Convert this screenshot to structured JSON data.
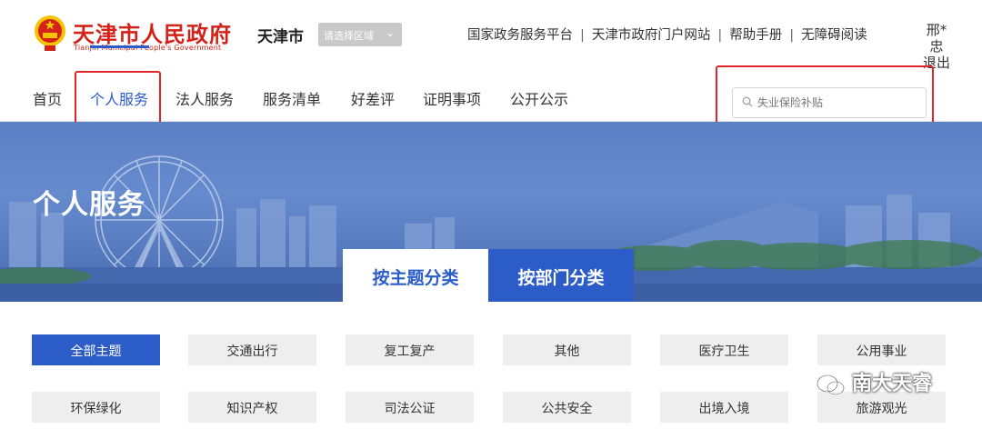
{
  "header": {
    "site_title": "天津市人民政府",
    "site_subtitle": "Tianjin Municipal People's Government",
    "city": "天津市",
    "region_select": {
      "placeholder": "请选择区域"
    },
    "top_links": [
      "国家政务服务平台",
      "天津市政府门户网站",
      "帮助手册",
      "无障碍阅读"
    ],
    "user_name": "邢*忠",
    "logout": "退出"
  },
  "nav": {
    "items": [
      "首页",
      "个人服务",
      "法人服务",
      "服务清单",
      "好差评",
      "证明事项",
      "公开公示"
    ],
    "active_index": 1
  },
  "search": {
    "placeholder": "失业保险补贴"
  },
  "banner": {
    "title": "个人服务",
    "tabs": [
      "按主题分类",
      "按部门分类"
    ],
    "active_tab": 0
  },
  "categories": {
    "items": [
      "全部主题",
      "交通出行",
      "复工复产",
      "其他",
      "医疗卫生",
      "公用事业",
      "环保绿化",
      "知识产权",
      "司法公证",
      "公共安全",
      "出境入境",
      "旅游观光"
    ],
    "active_index": 0
  },
  "watermark": "南大天睿",
  "colors": {
    "brand_red": "#d32219",
    "accent_blue": "#2b5cc7",
    "highlight_red": "#e0262a",
    "tile_gray": "#eeeeee"
  }
}
